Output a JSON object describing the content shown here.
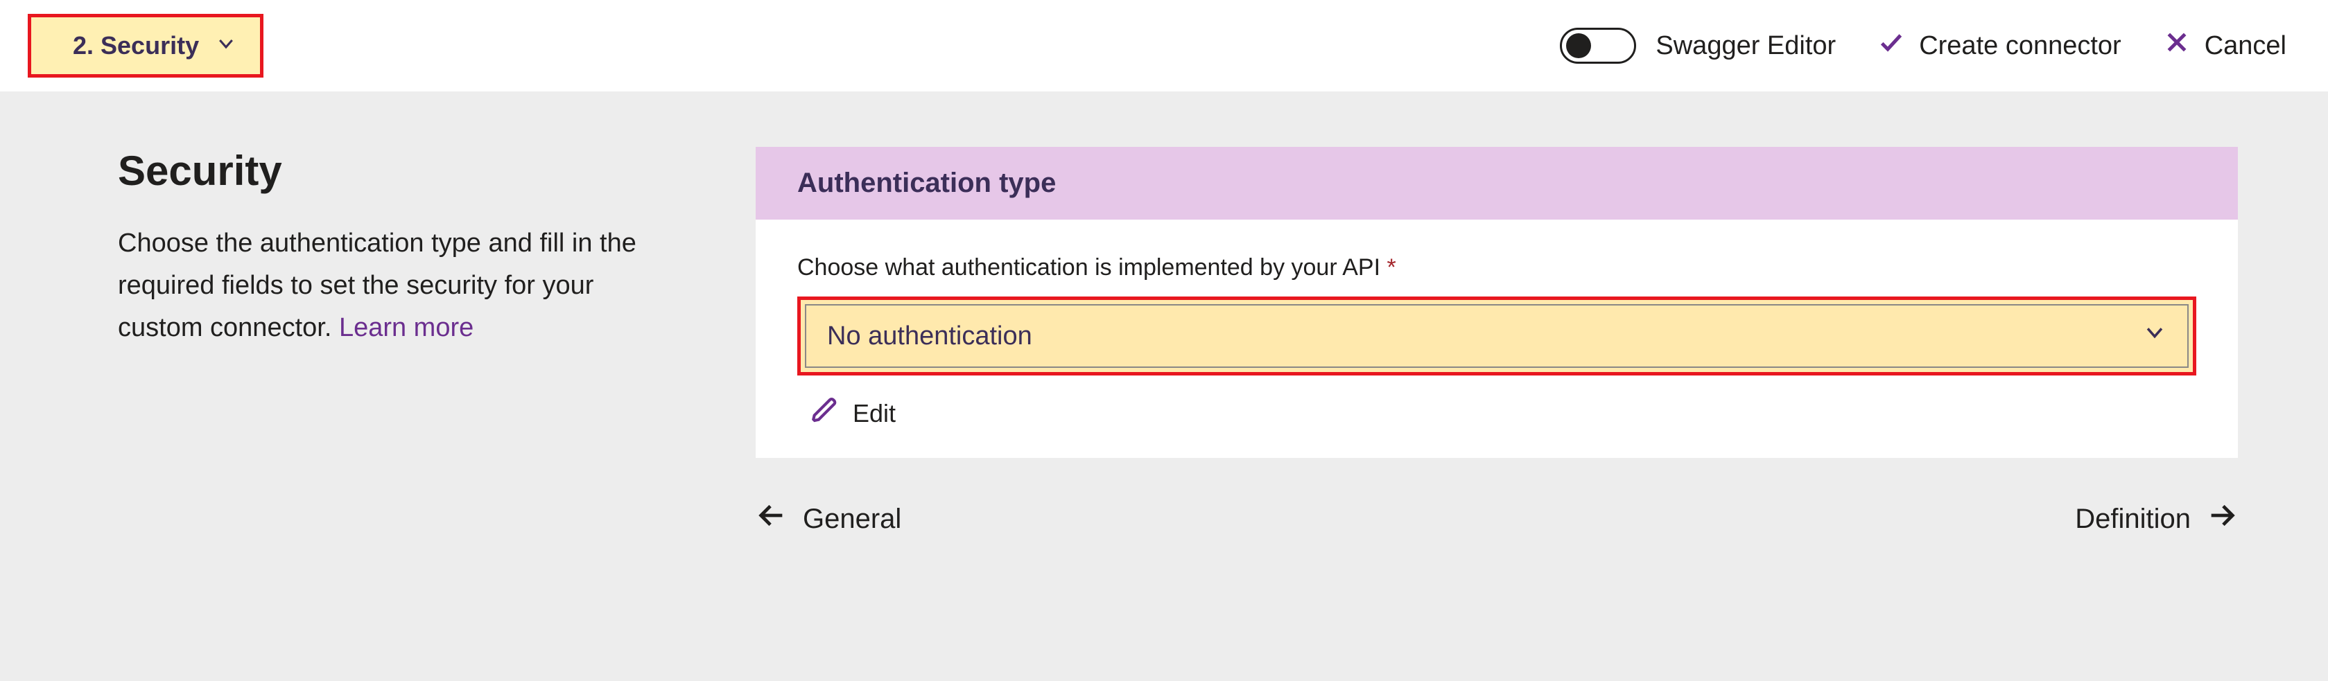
{
  "topbar": {
    "step_label": "2. Security",
    "swagger_label": "Swagger Editor",
    "create_label": "Create connector",
    "cancel_label": "Cancel"
  },
  "left": {
    "heading": "Security",
    "blurb_pre": "Choose the authentication type and fill in the required fields to set the security for your custom connector. ",
    "learn_more": "Learn more"
  },
  "card": {
    "header": "Authentication type",
    "field_label": "Choose what authentication is implemented by your API",
    "required_mark": "*",
    "selected_value": "No authentication",
    "edit_label": "Edit"
  },
  "nav": {
    "prev": "General",
    "next": "Definition"
  }
}
